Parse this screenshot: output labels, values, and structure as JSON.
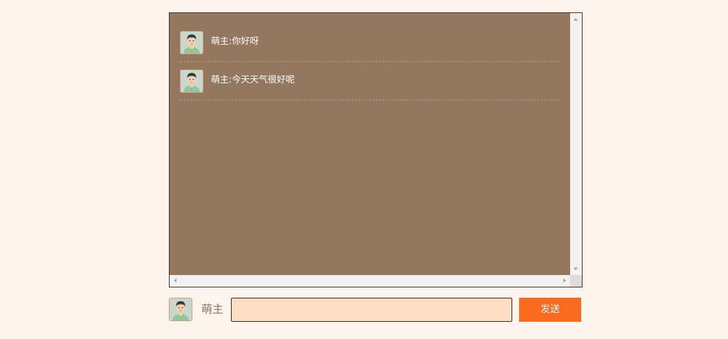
{
  "chat": {
    "messages": [
      {
        "text": "萌主:你好呀",
        "avatar_icon": "user-avatar-icon"
      },
      {
        "text": "萌主:今天天气很好呢",
        "avatar_icon": "user-avatar-icon"
      }
    ]
  },
  "composer": {
    "username": "萌主",
    "input_value": "",
    "input_placeholder": "",
    "send_label": "发送",
    "avatar_icon": "user-avatar-icon"
  },
  "colors": {
    "page_background": "#fdf4ee",
    "chat_background": "#93775e",
    "message_divider": "#c99a67",
    "input_background": "#ffdec3",
    "send_button": "#fa6b20"
  }
}
